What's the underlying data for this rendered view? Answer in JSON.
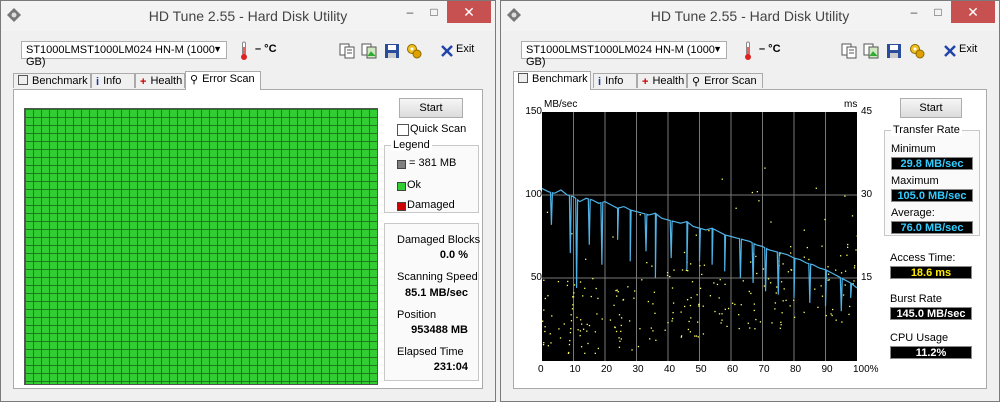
{
  "window1": {
    "title": "HD Tune 2.55 - Hard Disk Utility",
    "drive": "ST1000LMST1000LM024 HN-M (1000 GB)",
    "temperature": "– °C",
    "exit_label": "Exit",
    "tabs": [
      "Benchmark",
      "Info",
      "Health",
      "Error Scan"
    ],
    "active_tab": "Error Scan",
    "start_label": "Start",
    "quick_scan_label": "Quick Scan",
    "legend": {
      "title": "Legend",
      "block_size": "= 381 MB",
      "ok": "Ok",
      "damaged": "Damaged"
    },
    "stats": {
      "damaged_blocks_label": "Damaged Blocks",
      "damaged_blocks_value": "0.0 %",
      "scanning_speed_label": "Scanning Speed",
      "scanning_speed_value": "85.1 MB/sec",
      "position_label": "Position",
      "position_value": "953488 MB",
      "elapsed_label": "Elapsed Time",
      "elapsed_value": "231:04"
    },
    "colors": {
      "ok": "#32cd32",
      "damaged": "#cc0000",
      "block": "#808080"
    }
  },
  "window2": {
    "title": "HD Tune 2.55 - Hard Disk Utility",
    "drive": "ST1000LMST1000LM024 HN-M (1000 GB)",
    "temperature": "– °C",
    "exit_label": "Exit",
    "tabs": [
      "Benchmark",
      "Info",
      "Health",
      "Error Scan"
    ],
    "active_tab": "Benchmark",
    "start_label": "Start",
    "transfer_rate": {
      "title": "Transfer Rate",
      "minimum_label": "Minimum",
      "minimum_value": "29.8 MB/sec",
      "maximum_label": "Maximum",
      "maximum_value": "105.0 MB/sec",
      "average_label": "Average:",
      "average_value": "76.0 MB/sec"
    },
    "access_time_label": "Access Time:",
    "access_time_value": "18.6 ms",
    "burst_rate_label": "Burst Rate",
    "burst_rate_value": "145.0 MB/sec",
    "cpu_usage_label": "CPU Usage",
    "cpu_usage_value": "11.2%"
  },
  "chart_data": {
    "type": "line",
    "ylabel": "MB/sec",
    "y2label": "ms",
    "ylim": [
      0,
      150
    ],
    "y2lim": [
      0,
      45
    ],
    "yticks": [
      "150",
      "100",
      "50"
    ],
    "y2ticks": [
      "45",
      "30",
      "15"
    ],
    "xlim": [
      0,
      100
    ],
    "xticks": [
      "0",
      "10",
      "20",
      "30",
      "40",
      "50",
      "60",
      "70",
      "80",
      "90",
      "100%"
    ],
    "grid": true,
    "series": [
      {
        "color": "#4fb3e8",
        "x": [
          0,
          2,
          4,
          6,
          8,
          10,
          12,
          14,
          16,
          18,
          20,
          22,
          24,
          26,
          28,
          30,
          32,
          34,
          36,
          38,
          40,
          42,
          44,
          46,
          48,
          50,
          52,
          54,
          56,
          58,
          60,
          62,
          64,
          66,
          68,
          70,
          72,
          74,
          76,
          78,
          80,
          82,
          84,
          86,
          88,
          90,
          92,
          94,
          96,
          98,
          100
        ],
        "y": [
          104,
          102,
          101,
          103,
          100,
          99,
          96,
          98,
          97,
          95,
          96,
          94,
          92,
          93,
          91,
          90,
          89,
          88,
          89,
          86,
          85,
          84,
          83,
          84,
          81,
          80,
          79,
          80,
          78,
          76,
          75,
          74,
          73,
          72,
          70,
          69,
          67,
          66,
          65,
          64,
          62,
          61,
          59,
          58,
          56,
          55,
          53,
          51,
          49,
          47,
          44
        ],
        "dips": [
          {
            "x": 3,
            "y": 82
          },
          {
            "x": 9,
            "y": 65
          },
          {
            "x": 11,
            "y": 44
          },
          {
            "x": 15,
            "y": 70
          },
          {
            "x": 19,
            "y": 58
          },
          {
            "x": 24,
            "y": 73
          },
          {
            "x": 28,
            "y": 60
          },
          {
            "x": 33,
            "y": 66
          },
          {
            "x": 36,
            "y": 50
          },
          {
            "x": 41,
            "y": 62
          },
          {
            "x": 46,
            "y": 55
          },
          {
            "x": 50,
            "y": 60
          },
          {
            "x": 54,
            "y": 58
          },
          {
            "x": 58,
            "y": 54
          },
          {
            "x": 63,
            "y": 50
          },
          {
            "x": 67,
            "y": 47
          },
          {
            "x": 71,
            "y": 42
          },
          {
            "x": 75,
            "y": 40
          },
          {
            "x": 80,
            "y": 38
          },
          {
            "x": 85,
            "y": 35
          },
          {
            "x": 90,
            "y": 33
          },
          {
            "x": 95,
            "y": 30
          },
          {
            "x": 98,
            "y": 38
          }
        ]
      },
      {
        "color": "#ffff66",
        "type": "scatter",
        "note_range_ms": [
          5,
          30
        ],
        "points": "random-access"
      }
    ]
  }
}
